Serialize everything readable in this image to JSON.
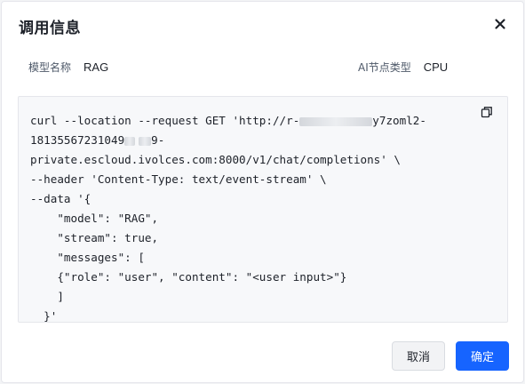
{
  "dialog": {
    "title": "调用信息",
    "close_icon": "close-icon"
  },
  "meta": {
    "model_name_label": "模型名称",
    "model_name_value": "RAG",
    "node_type_label": "AI节点类型",
    "node_type_value": "CPU"
  },
  "code": {
    "copy_icon": "copy-icon",
    "line1_prefix": "curl --location --request GET 'http://r-",
    "line1_suffix": "y7zoml2-",
    "line2_prefix": "18135567231049",
    "line2_suffix": "9-",
    "line3": "private.escloud.ivolces.com:8000/v1/chat/completions' \\",
    "line4": "--header 'Content-Type: text/event-stream' \\",
    "line5": "--data '{",
    "line6": "    \"model\": \"RAG\",",
    "line7": "    \"stream\": true,",
    "line8": "    \"messages\": [",
    "line9": "    {\"role\": \"user\", \"content\": \"<user input>\"}",
    "line10": "    ]",
    "line11": "  }'"
  },
  "footer": {
    "cancel_label": "取消",
    "ok_label": "确定"
  },
  "colors": {
    "primary": "#1664ff",
    "code_background": "#f7f8fa",
    "text": "#1d2129"
  }
}
